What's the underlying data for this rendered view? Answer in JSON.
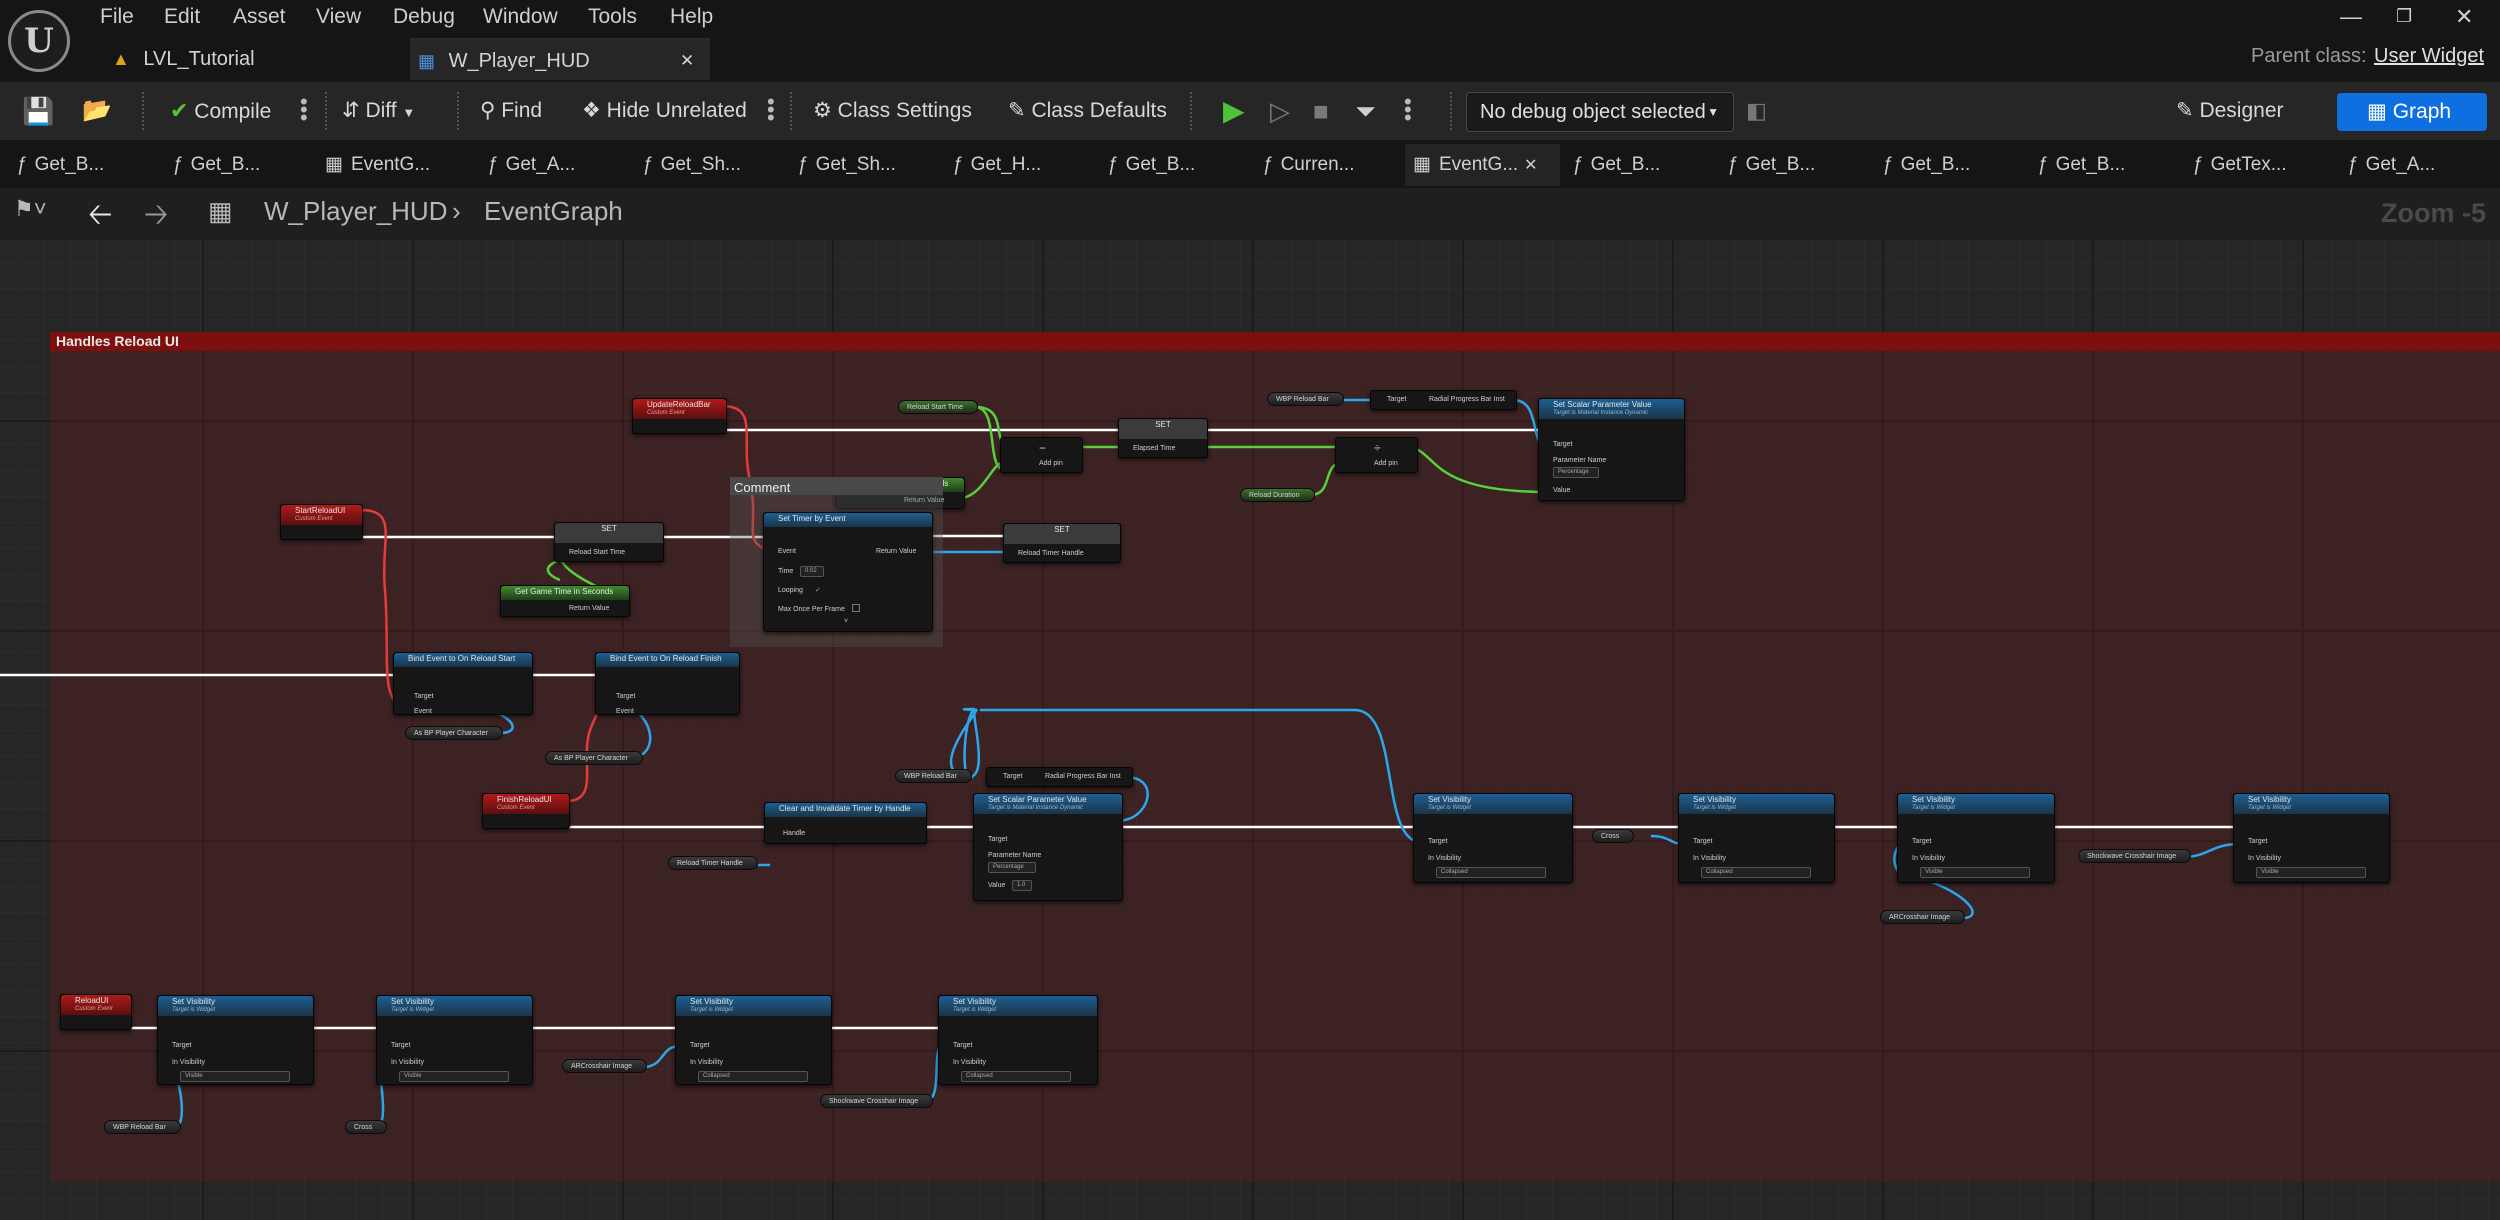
{
  "menu": [
    "File",
    "Edit",
    "Asset",
    "View",
    "Debug",
    "Window",
    "Tools",
    "Help"
  ],
  "tabs": [
    {
      "label": "LVL_Tutorial"
    },
    {
      "label": "W_Player_HUD"
    }
  ],
  "parent_class_label": "Parent class:",
  "parent_class_value": "User Widget",
  "toolbar": {
    "compile": "Compile",
    "diff": "Diff",
    "find": "Find",
    "hide_unrelated": "Hide Unrelated",
    "class_settings": "Class Settings",
    "class_defaults": "Class Defaults",
    "debug_object": "No debug object selected",
    "designer": "Designer",
    "graph": "Graph"
  },
  "function_tabs": [
    "Get_B...",
    "Get_B...",
    "EventG...",
    "Get_A...",
    "Get_Sh...",
    "Get_Sh...",
    "Get_H...",
    "Get_B...",
    "Curren...",
    "EventG...",
    "Get_B...",
    "Get_B...",
    "Get_B...",
    "Get_B...",
    "GetTex...",
    "Get_A..."
  ],
  "breadcrumb": {
    "blueprint": "W_Player_HUD",
    "graph": "EventGraph"
  },
  "zoom": "Zoom -5",
  "comment_title": "Handles Reload UI",
  "nodes": {
    "update_reload_bar": {
      "title": "UpdateReloadBar",
      "sub": "Custom Event"
    },
    "start_reload_ui": {
      "title": "StartReloadUI",
      "sub": "Custom Event"
    },
    "finish_reload_ui": {
      "title": "FinishReloadUI",
      "sub": "Custom Event"
    },
    "reload_ui": {
      "title": "ReloadUI",
      "sub": "Custom Event"
    },
    "set": "SET",
    "reload_start_time": "Reload Start Time",
    "elapsed_time": "Elapsed Time",
    "reload_timer_handle": "Reload Timer Handle",
    "reload_duration": "Reload Duration",
    "get_game_time": {
      "title": "Get Game Time in Seconds",
      "ret": "Return Value"
    },
    "add_pin": "Add pin",
    "comment": "Comment",
    "set_timer": {
      "title": "Set Timer by Event",
      "event": "Event",
      "time": "Time",
      "time_val": "0.02",
      "looping": "Looping",
      "max_once": "Max Once Per Frame",
      "ret": "Return Value"
    },
    "set_scalar": {
      "title": "Set Scalar Parameter Value",
      "sub": "Target is Material Instance Dynamic",
      "target": "Target",
      "param_name": "Parameter Name",
      "param_val": "Percentage",
      "value": "Value",
      "value_val": "1.0"
    },
    "wbp_reload_bar": "WBP Reload Bar",
    "radial_progress": "Radial Progress Bar Inst",
    "bind_start": "Bind Event to On Reload Start",
    "bind_finish": "Bind Event to On Reload Finish",
    "as_bp_player": "As BP Player Character",
    "clear_timer": {
      "title": "Clear and Invalidate Timer by Handle",
      "handle": "Handle"
    },
    "set_visibility": {
      "title": "Set Visibility",
      "sub": "Target is Widget",
      "target": "Target",
      "in_vis": "In Visibility"
    },
    "vis_collapsed": "Collapsed",
    "vis_visible": "Visible",
    "ar_crosshair": "ARCrosshair Image",
    "shockwave_crosshair": "Shockwave Crosshair Image",
    "cross": "Cross",
    "target": "Target",
    "event": "Event"
  },
  "colors": {
    "accent": "#0e70e0",
    "comment": "#7e0f0f",
    "exec": "#ffffff",
    "object_pin": "#2aa8ec",
    "float_pin": "#57d13d",
    "delegate_pin": "#e43b3b"
  }
}
